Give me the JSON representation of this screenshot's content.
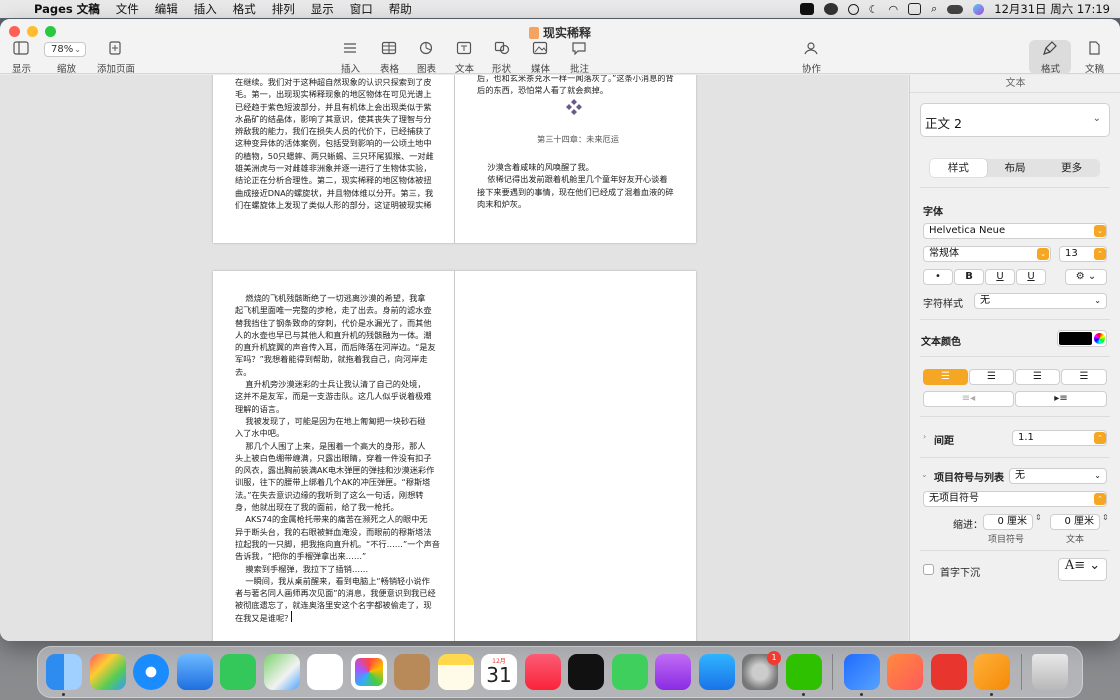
{
  "menubar": {
    "app_name": "Pages 文稿",
    "items": [
      "文件",
      "编辑",
      "插入",
      "格式",
      "排列",
      "显示",
      "窗口",
      "帮助"
    ],
    "date_time": "12月31日 周六  17:19"
  },
  "window": {
    "title": "现实稀释",
    "zoom_value": "78%",
    "toolbar": {
      "display": "显示",
      "zoom": "缩放",
      "add_page": "添加页面",
      "insert": "插入",
      "table": "表格",
      "chart": "图表",
      "text": "文本",
      "shape": "形状",
      "media": "媒体",
      "comment": "批注",
      "collaborate": "协作",
      "format": "格式",
      "document": "文稿"
    }
  },
  "pages": {
    "top_left": "在继续。我们对于这种超自然现象的认识只探索到了皮\n毛。第一，出现现实稀释现象的地区物体在可见光谱上\n已经趋于紫色短波部分，并且有机体上会出现类似于紫\n水晶矿的结晶体，影响了其意识，使其丧失了理智与分\n辨敌我的能力，我们在损失人员的代价下，已经捕获了\n这种变异体的活体案例，包括受到影响的一公顷土地中\n的植物，50只蟋蟀、两只蜥蜴、三只环尾狐猴、一对雌\n雄美洲虎与一对雌雄非洲象并逐一进行了生物体实验，\n结论正在分析合理性。第二，现实稀释的地区物体被扭\n曲成接近DNA的螺旋状，并且物体维以分开。第三，我\n们在螺旋体上发现了类似人形的部分，这证明被现实稀",
    "top_right_lines": "后，也和玄米茶兑水一样一闻落灰了。”这条小消息的背\n后的东西，恐怕常人看了就会疯掉。",
    "chapter_title": "第三十四章：未来厄运",
    "top_right_body": "    沙漠含着咸味的风唤醒了我。\n    依稀记得出发前跟着机舱里几个童年好友开心谈着\n接下来要遇到的事情，现在他们已经成了混着血液的碎\n肉末和炉灰。",
    "bottom_left": "    燃烧的飞机残骸断绝了一切逃离沙漠的希望，我拿\n起飞机里面唯一完整的步枪，走了出去。身前的滤水壶\n替我挡住了钢条致命的穿刺，代价是水漏光了，而其他\n人的水壶也早已与其他人和直升机的残骸融为一体。潮\n的直升机旋翼的声音传入耳，而后降落在河岸边。“是友\n军吗？”我想着能得到帮助，就拖着我自己，向河岸走\n去。\n    直升机旁沙漠迷彩的士兵让我认清了自己的处境，\n这并不是友军，而是一支游击队。这几人似乎说着极难\n理解的语言。\n    我被发现了，可能是因为在地上匍匐把一块砂石碰\n入了水中吧。\n    那几个人围了上来，是围着一个高大的身形，那人\n头上被白色绷带缠满，只露出眼睛，穿着一件没有扣子\n的风衣，露出胸前装满AK电木弹匣的弹挂和沙漠迷彩作\n训服，往下的腰带上绑着几个AK的冲压弹匣。“穆斯塔\n法。”在失去意识边缘的我听到了这么一句话，刚想转\n身，他就出现在了我的面前，给了我一枪托。\n    AKS74的金属枪托带来的痛苦在濒死之人的眼中无\n异于断头台，我的右眼被鲜血淹没，而眼前的穆斯塔法\n拉起我的一只脚，把我拖向直升机。“不行……”一个声音\n告诉我，“把你的手榴弹拿出来……”\n    摸索到手榴弹，我拉下了插销……\n    一瞬间，我从桌前醒来，看到电脑上“畅销轻小说作\n者与著名同人画师再次见面”的消息，我便意识到我已经\n被彻底遗忘了，就连奥洛里安这个名字都被偷走了，现\n在我又是谁呢？"
  },
  "sidebar": {
    "header": "文本",
    "paragraph_style": "正文 2",
    "tabs": [
      "样式",
      "布局",
      "更多"
    ],
    "font_section": "字体",
    "font_family": "Helvetica Neue",
    "font_weight": "常规体",
    "font_size": "13",
    "char_style_label": "字符样式",
    "char_style_value": "无",
    "text_color_label": "文本颜色",
    "spacing_label": "间距",
    "spacing_value": "1.1",
    "bullets_label": "项目符号与列表",
    "bullets_value": "无",
    "bullet_type": "无项目符号",
    "indent_label": "缩进：",
    "indent_bullet_value": "0 厘米",
    "indent_text_value": "0 厘米",
    "indent_bullet_caption": "项目符号",
    "indent_text_caption": "文本",
    "dropcap_label": "首字下沉",
    "inline_btns": [
      "•",
      "B",
      "U",
      "U"
    ]
  },
  "dock": {
    "calendar_month": "12月",
    "calendar_day": "31",
    "settings_badge": "1"
  }
}
